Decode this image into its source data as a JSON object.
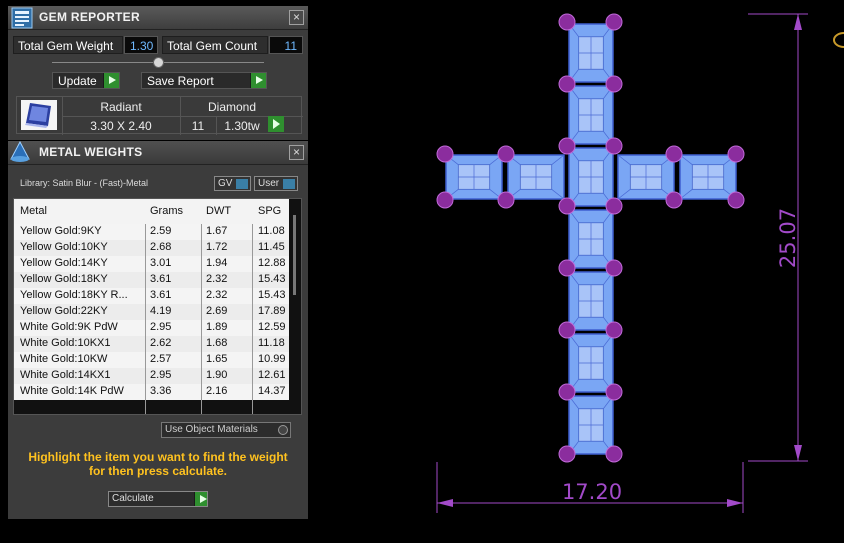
{
  "gem_reporter": {
    "title": "GEM REPORTER",
    "close_label": "×",
    "total_weight_label": "Total Gem Weight",
    "total_weight_value": "1.30",
    "total_count_label": "Total Gem Count",
    "total_count_value": "11",
    "update_label": "Update",
    "save_report_label": "Save Report",
    "gem_table": {
      "shape_header": "Radiant",
      "shape_value": "3.30 X 2.40",
      "type_header": "Diamond",
      "count_value": "11",
      "weight_value": "1.30tw"
    }
  },
  "metal_weights": {
    "title": "METAL WEIGHTS",
    "close_label": "×",
    "library_text": "Library: Satin Blur - (Fast)-Metal",
    "toggle_gv": "GV",
    "toggle_user": "User",
    "columns": [
      "Metal",
      "Grams",
      "DWT",
      "SPG"
    ],
    "rows": [
      {
        "metal": "Yellow Gold:9KY",
        "grams": "2.59",
        "dwt": "1.67",
        "spg": "11.08"
      },
      {
        "metal": "Yellow Gold:10KY",
        "grams": "2.68",
        "dwt": "1.72",
        "spg": "11.45"
      },
      {
        "metal": "Yellow Gold:14KY",
        "grams": "3.01",
        "dwt": "1.94",
        "spg": "12.88"
      },
      {
        "metal": "Yellow Gold:18KY",
        "grams": "3.61",
        "dwt": "2.32",
        "spg": "15.43"
      },
      {
        "metal": "Yellow Gold:18KY R...",
        "grams": "3.61",
        "dwt": "2.32",
        "spg": "15.43"
      },
      {
        "metal": "Yellow Gold:22KY",
        "grams": "4.19",
        "dwt": "2.69",
        "spg": "17.89"
      },
      {
        "metal": "White Gold:9K PdW",
        "grams": "2.95",
        "dwt": "1.89",
        "spg": "12.59"
      },
      {
        "metal": "White Gold:10KX1",
        "grams": "2.62",
        "dwt": "1.68",
        "spg": "11.18"
      },
      {
        "metal": "White Gold:10KW",
        "grams": "2.57",
        "dwt": "1.65",
        "spg": "10.99"
      },
      {
        "metal": "White Gold:14KX1",
        "grams": "2.95",
        "dwt": "1.90",
        "spg": "12.61"
      },
      {
        "metal": "White Gold:14K PdW",
        "grams": "3.36",
        "dwt": "2.16",
        "spg": "14.37"
      }
    ],
    "use_object_materials_label": "Use Object Materials",
    "hint_line1": "Highlight the item you want to find the weight",
    "hint_line2": "for then press calculate.",
    "calculate_label": "Calculate"
  },
  "viewport": {
    "height_dimension": "25.07",
    "width_dimension": "17.20",
    "colors": {
      "gem_fill": "#7aa6f4",
      "prong": "#8b2d9e",
      "dimension": "#a24ac9"
    }
  }
}
